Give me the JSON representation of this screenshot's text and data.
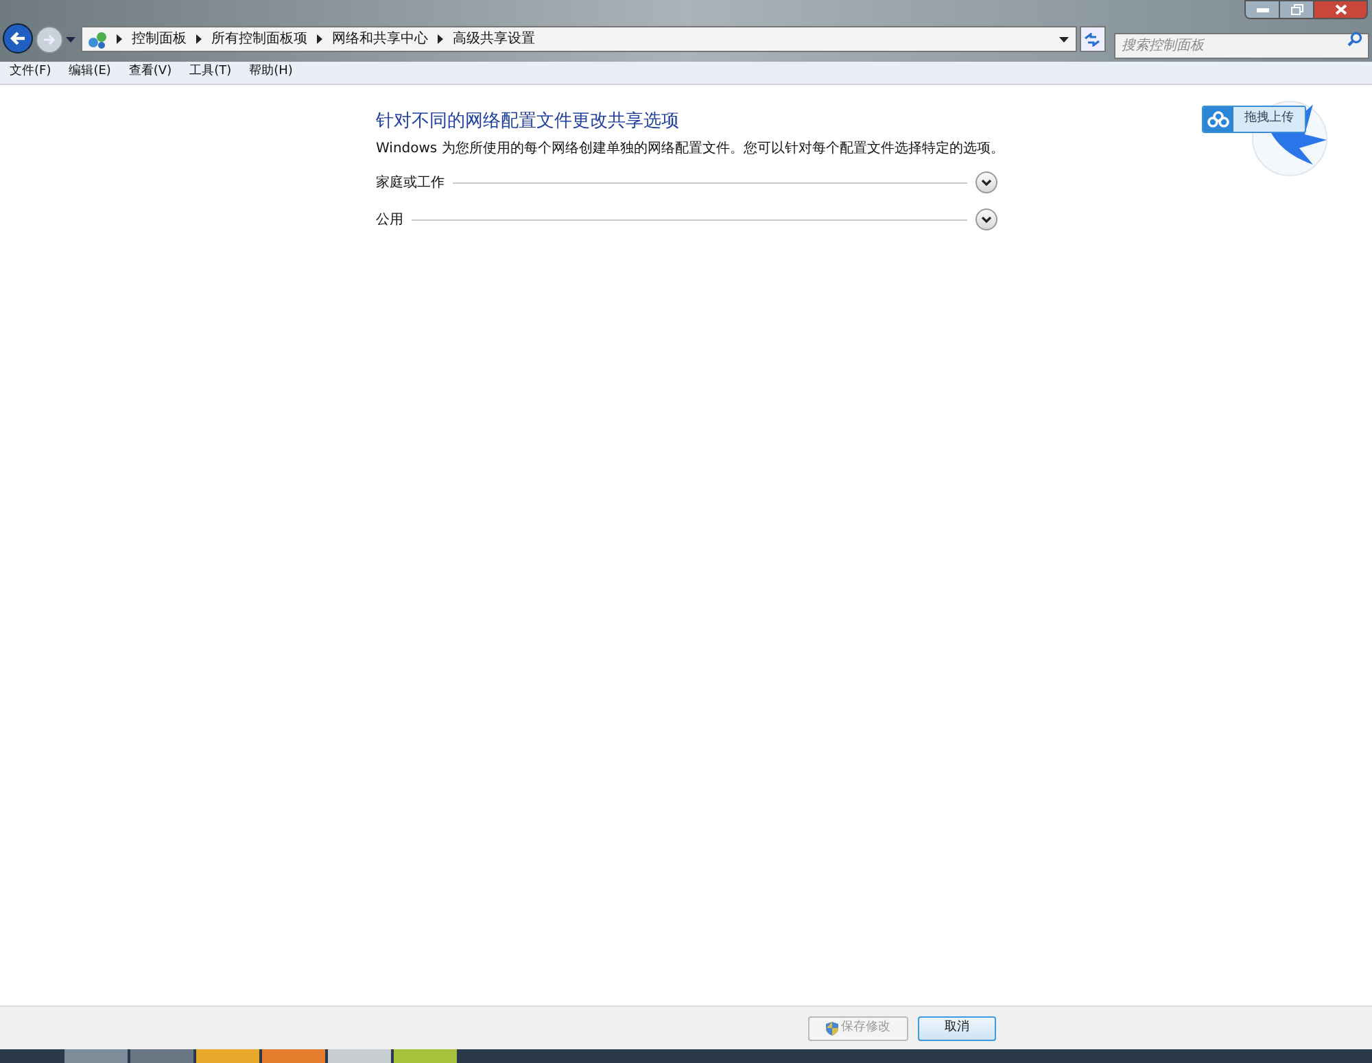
{
  "address_bar": {
    "breadcrumbs": [
      "控制面板",
      "所有控制面板项",
      "网络和共享中心",
      "高级共享设置"
    ]
  },
  "search": {
    "placeholder": "搜索控制面板"
  },
  "menu": [
    "文件(F)",
    "编辑(E)",
    "查看(V)",
    "工具(T)",
    "帮助(H)"
  ],
  "content": {
    "title": "针对不同的网络配置文件更改共享选项",
    "description": "Windows 为您所使用的每个网络创建单独的网络配置文件。您可以针对每个配置文件选择特定的选项。",
    "sections": [
      {
        "label": "家庭或工作",
        "expanded": false
      },
      {
        "label": "公用",
        "expanded": false
      }
    ]
  },
  "upload_widget": {
    "label": "拖拽上传"
  },
  "buttons": [
    {
      "label": "保存修改",
      "kind": "shield",
      "disabled": true
    },
    {
      "label": "取消",
      "kind": "plain",
      "disabled": false
    }
  ]
}
